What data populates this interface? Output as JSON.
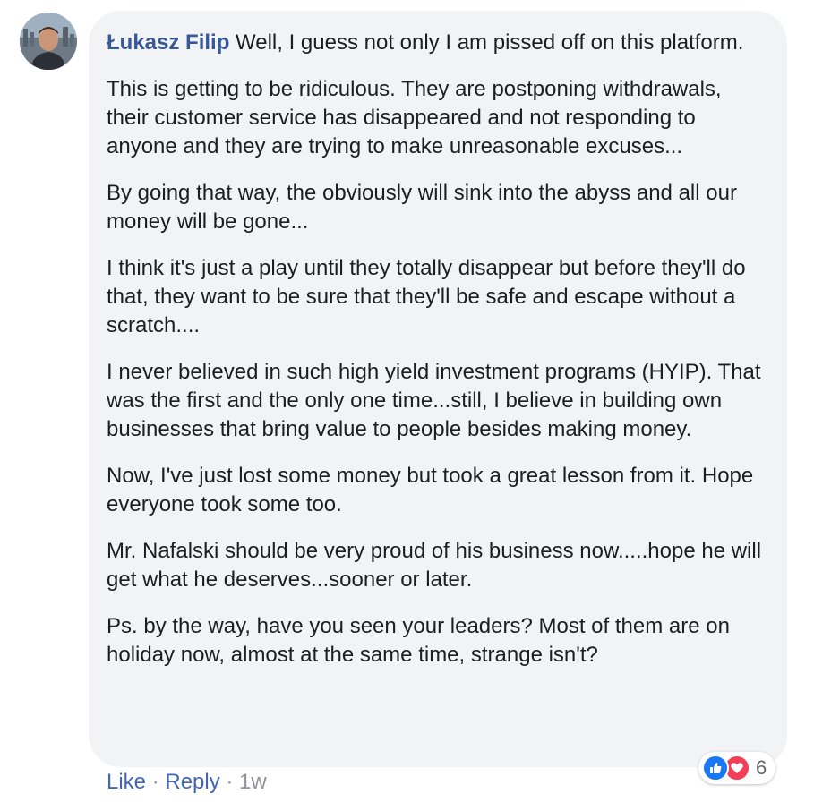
{
  "comment": {
    "author": "Łukasz Filip",
    "first_line": "Well, I guess not only I am pissed off on this platform.",
    "paragraphs": [
      "This is getting to be ridiculous. They are postponing withdrawals, their customer service has disappeared and not responding to anyone and they are trying to make unreasonable excuses...",
      "By going that way, the obviously will sink into the abyss and all our money will be gone...",
      "I think it's just a play until they totally disappear but before they'll do that, they want to be sure that they'll be safe and escape without a scratch....",
      "I never believed in such high yield investment programs (HYIP). That was the first and the only one time...still, I believe in building own businesses that bring value to people besides making money.",
      "Now, I've just lost some money but took a great lesson from it. Hope everyone took some too.",
      "Mr. Nafalski should be very proud of his business now.....hope he will get what he deserves...sooner or later.",
      "Ps. by the way, have you seen your leaders? Most of them are on holiday now, almost at the same time, strange isn't?"
    ]
  },
  "actions": {
    "like_label": "Like",
    "separator": " · ",
    "reply_label": "Reply",
    "time": "1w"
  },
  "reactions": {
    "icons": [
      "like-icon",
      "love-icon"
    ],
    "count": "6",
    "like_color": "#1877f2",
    "love_color": "#f33e58"
  },
  "colors": {
    "bubble_bg": "#f2f3f5",
    "author_link": "#385898",
    "action_link": "#4267b2",
    "muted": "#90949c"
  }
}
